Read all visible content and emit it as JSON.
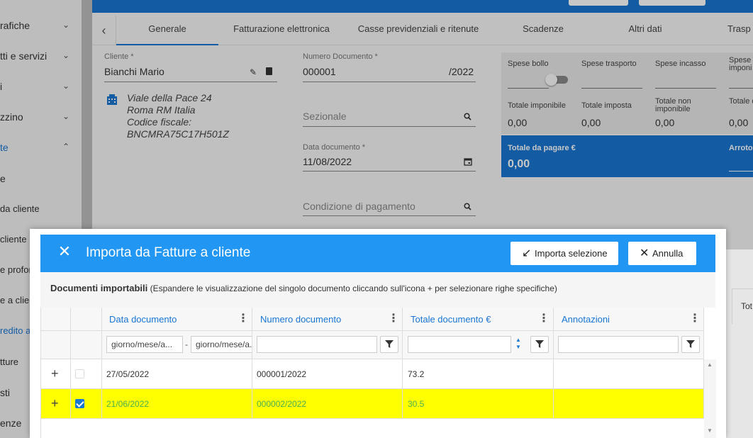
{
  "sidebar": {
    "items": [
      {
        "label": "rafiche",
        "chevron": "⌄"
      },
      {
        "label": "tti e servizi",
        "chevron": "⌄"
      },
      {
        "label": "i",
        "chevron": "⌄"
      },
      {
        "label": "zzino",
        "chevron": "⌄"
      },
      {
        "label": "te",
        "chevron": "⌃"
      },
      {
        "label": "e"
      },
      {
        "label": "da cliente"
      },
      {
        "label": "cliente"
      },
      {
        "label": "e profor"
      },
      {
        "label": "e a clien"
      },
      {
        "label": "redito a"
      },
      {
        "label": "tture"
      },
      {
        "label": "sti"
      },
      {
        "label": "enze"
      }
    ]
  },
  "tabs": [
    {
      "label": "Generale"
    },
    {
      "label": "Fatturazione elettronica"
    },
    {
      "label": "Casse previdenziali e ritenute"
    },
    {
      "label": "Scadenze"
    },
    {
      "label": "Altri dati"
    },
    {
      "label": "Trasp"
    }
  ],
  "form": {
    "cliente_label": "Cliente *",
    "cliente_value": "Bianchi Mario",
    "address_line1": "Viale della Pace 24",
    "address_line2": "Roma RM Italia",
    "address_line3": "Codice fiscale:",
    "address_line4": "BNCMRA75C17H501Z",
    "numero_label": "Numero Documento *",
    "numero_value": "000001",
    "numero_suffix": "/2022",
    "sezionale_placeholder": "Sezionale",
    "data_label": "Data documento *",
    "data_value": "11/08/2022",
    "condizione_placeholder": "Condizione di pagamento"
  },
  "totals": {
    "spese_bollo": "Spese bollo",
    "spese_trasporto": "Spese trasporto",
    "spese_incasso": "Spese incasso",
    "spese_imponi": "Spese\nimponi",
    "totale_imponibile": "Totale imponibile",
    "totale_imponibile_val": "0,00",
    "totale_imposta": "Totale imposta",
    "totale_imposta_val": "0,00",
    "totale_non_imponibile": "Totale non imponibile",
    "totale_non_imponibile_val": "0,00",
    "totale_docum": "Totale docum",
    "totale_docum_val": "0,00",
    "totale_pagare_label": "Totale da pagare €",
    "totale_pagare_val": "0,00",
    "arrotond": "Arroton"
  },
  "modal": {
    "title": "Importa da Fatture a cliente",
    "importa_label": "Importa selezione",
    "annulla_label": "Annulla",
    "subtitle_bold": "Documenti importabili",
    "subtitle_rest": "(Espandere le visualizzazione del singolo documento cliccando sull'icona + per selezionare righe specifiche)",
    "columns": [
      "Data documento",
      "Numero documento",
      "Totale documento €",
      "Annotazioni"
    ],
    "filter_from_placeholder": "giorno/mese/a...",
    "filter_to_placeholder": "giorno/mese/a...",
    "filter_dash": "-",
    "rows": [
      {
        "data": "27/05/2022",
        "numero": "000001/2022",
        "totale": "73.2",
        "annotazioni": "",
        "selected": false
      },
      {
        "data": "21/06/2022",
        "numero": "000002/2022",
        "totale": "30.5",
        "annotazioni": "",
        "selected": true
      }
    ]
  },
  "background_right": {
    "tot_label": "Tot"
  }
}
